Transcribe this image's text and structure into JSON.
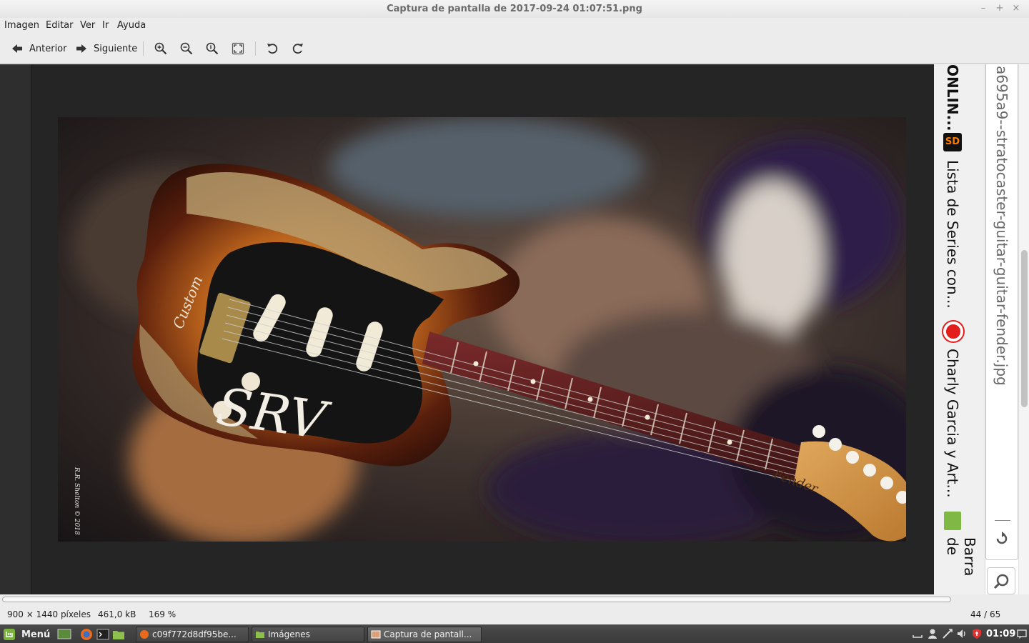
{
  "window": {
    "title": "Captura de pantalla de 2017-09-24 01:07:51.png",
    "controls": [
      "minimize-icon",
      "maximize-icon",
      "close-icon"
    ],
    "minimize_glyph": "–",
    "maximize_glyph": "+",
    "close_glyph": "×"
  },
  "menu": {
    "items": [
      "Imagen",
      "Editar",
      "Ver",
      "Ir",
      "Ayuda"
    ]
  },
  "toolbar": {
    "prev_label": "Anterior",
    "next_label": "Siguiente",
    "icons": [
      "arrow-left-icon",
      "arrow-right-icon",
      "zoom-in-icon",
      "zoom-out-icon",
      "zoom-normal-icon",
      "zoom-fit-icon",
      "rotate-left-icon",
      "rotate-right-icon"
    ]
  },
  "image": {
    "signature": "R.R. Shelton © 2018",
    "pickguard_text": "SRV",
    "bridge_text": "Custom",
    "headstock_text": "Fender"
  },
  "browser_fragment": {
    "bookmarks": [
      "ONLIN...",
      "Lista de Series con...",
      "Charly Garcia y Art...",
      "Barra de"
    ],
    "url_text": "a695a9--stratocaster-guitar-guitar-fender.jpg",
    "bookmark_icons": [
      "sd-icon",
      "record-icon",
      "folder-icon"
    ]
  },
  "status": {
    "dimensions": "900 × 1440 píxeles",
    "filesize": "461,0 kB",
    "zoom": "169 %",
    "position": "44 / 65"
  },
  "taskbar": {
    "menu_label": "Menú",
    "tasks": [
      "c09f772d8df95be...",
      "Imágenes",
      "Captura de pantall..."
    ],
    "clock": "01:09"
  },
  "colors": {
    "accent_green": "#7bb33d",
    "window_bg": "#ececec",
    "viewer_bg": "#232323",
    "taskbar_bg": "#3f3f3f"
  }
}
